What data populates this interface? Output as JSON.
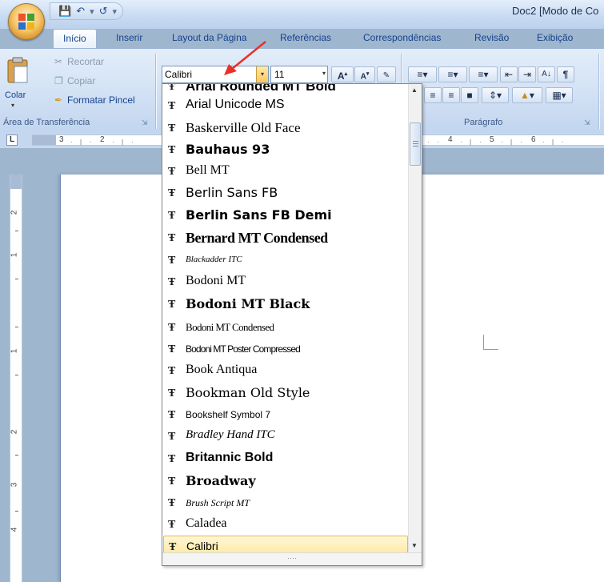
{
  "window": {
    "title": "Doc2 [Modo de Co",
    "quick_access": [
      "save",
      "undo",
      "redo",
      "customize"
    ]
  },
  "tabs": [
    {
      "label": "Início",
      "active": true
    },
    {
      "label": "Inserir"
    },
    {
      "label": "Layout da Página"
    },
    {
      "label": "Referências"
    },
    {
      "label": "Correspondências"
    },
    {
      "label": "Revisão"
    },
    {
      "label": "Exibição"
    }
  ],
  "clipboard": {
    "paste_label": "Colar",
    "cut_label": "Recortar",
    "copy_label": "Copiar",
    "format_painter_label": "Formatar Pincel",
    "group_label": "Área de Transferência"
  },
  "font_group": {
    "font_name": "Calibri",
    "font_size": "11",
    "grow_label": "A",
    "shrink_label": "A"
  },
  "paragraph": {
    "group_label": "Parágrafo",
    "sort_label": "A↓",
    "show_marks_label": "¶"
  },
  "ruler": {
    "corner_label": "L",
    "numbers": [
      "3",
      "2",
      "4",
      "5",
      "6"
    ],
    "vertical_numbers": [
      "2",
      "1",
      "1",
      "2",
      "3",
      "4"
    ]
  },
  "font_list": {
    "items": [
      "Arial Rounded MT Bold",
      "Arial Unicode MS",
      "Baskerville Old Face",
      "Bauhaus 93",
      "Bell MT",
      "Berlin Sans FB",
      "Berlin Sans FB Demi",
      "Bernard MT Condensed",
      "Blackadder ITC",
      "Bodoni MT",
      "Bodoni MT Black",
      "Bodoni MT Condensed",
      "Bodoni MT Poster Compressed",
      "Book Antiqua",
      "Bookman Old Style",
      "Bookshelf Symbol 7",
      "Bradley Hand ITC",
      "Britannic Bold",
      "Broadway",
      "Brush Script MT",
      "Caladea",
      "Calibri"
    ],
    "selected": "Calibri",
    "truetype_glyph": "Ŧ"
  },
  "colors": {
    "annotation_arrow": "#e8302a",
    "selection_fill": "#ffe79d",
    "ribbon_text": "#15428b"
  }
}
